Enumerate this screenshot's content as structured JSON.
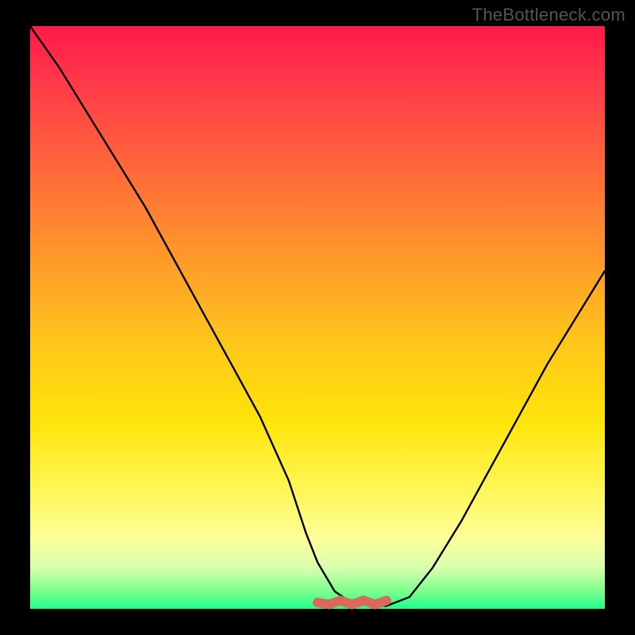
{
  "watermark": "TheBottleneck.com",
  "chart_data": {
    "type": "line",
    "title": "",
    "xlabel": "",
    "ylabel": "",
    "xlim": [
      0,
      100
    ],
    "ylim": [
      0,
      100
    ],
    "series": [
      {
        "name": "bottleneck-curve",
        "x": [
          0,
          5,
          10,
          15,
          20,
          25,
          30,
          35,
          40,
          45,
          48,
          50,
          53,
          56,
          60,
          62,
          66,
          70,
          75,
          80,
          85,
          90,
          95,
          100
        ],
        "y": [
          100,
          93,
          85,
          77,
          69,
          60,
          51,
          42,
          33,
          22,
          13,
          8,
          3,
          1,
          0.5,
          0.5,
          2,
          7,
          15,
          24,
          33,
          42,
          50,
          58
        ]
      }
    ],
    "annotations": [
      {
        "name": "optimal-band",
        "x_start": 50,
        "x_end": 62,
        "y": 0,
        "color": "#d86a5a"
      }
    ],
    "gradient_scale": {
      "top_color": "#ff1a4a",
      "mid_color": "#ffe40a",
      "bottom_color": "#1fff8c",
      "meaning_top": "worst",
      "meaning_bottom": "best"
    }
  }
}
